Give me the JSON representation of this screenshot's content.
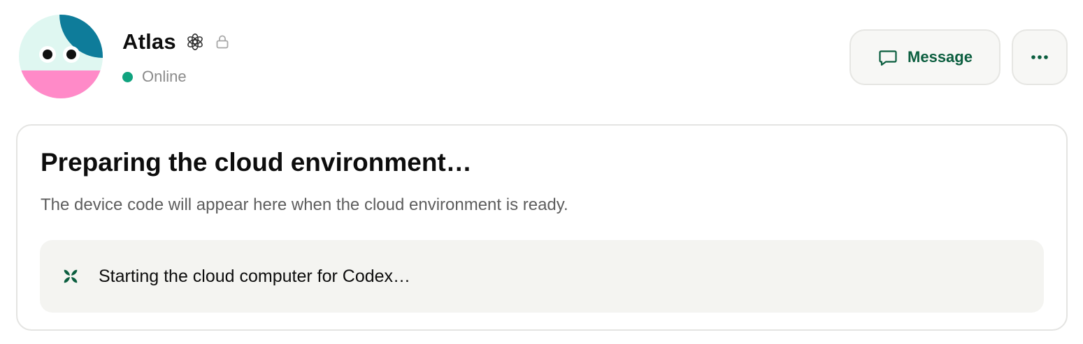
{
  "profile": {
    "name": "Atlas",
    "status": "Online",
    "verified_icon": "openai-logo-icon",
    "lock_icon": "lock-icon"
  },
  "actions": {
    "message_label": "Message",
    "message_icon": "chat-bubble-icon",
    "more_icon": "ellipsis-icon"
  },
  "card": {
    "title": "Preparing the cloud environment…",
    "description": "The device code will appear here when the cloud environment is ready.",
    "progress_text": "Starting the cloud computer for Codex…",
    "progress_icon": "spinner-icon"
  },
  "colors": {
    "accent_green": "#0b5e3f",
    "online_dot": "#10a37f",
    "avatar_mint": "#dff7f1",
    "avatar_teal": "#0e7c9a",
    "avatar_pink": "#ff8ac8"
  }
}
